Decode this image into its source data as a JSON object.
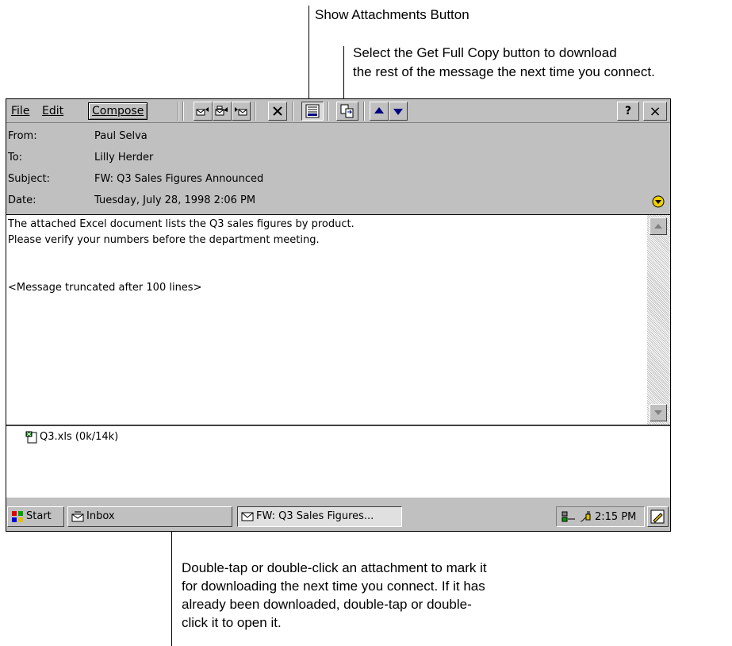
{
  "callouts": {
    "show_attachments": "Show Attachments Button",
    "get_full_copy_line1": "Select the Get Full Copy button to download",
    "get_full_copy_line2": "the rest of the message the next time you connect.",
    "attachment_line1": "Double-tap or double-click an attachment to mark it",
    "attachment_line2": "for downloading the next time you connect. If it has",
    "attachment_line3": "already been downloaded, double-tap or double-",
    "attachment_line4": "click it to open it."
  },
  "menu": {
    "file": "File",
    "edit": "Edit",
    "compose": "Compose",
    "help": "?",
    "close": "×"
  },
  "toolbar_icons": [
    "reply-icon",
    "reply-all-icon",
    "forward-icon",
    "delete-icon",
    "show-attachments-icon",
    "get-full-copy-icon",
    "previous-message-icon",
    "next-message-icon"
  ],
  "header": {
    "from_label": "From:",
    "from_value": "Paul Selva",
    "to_label": "To:",
    "to_value": "Lilly Herder",
    "subject_label": "Subject:",
    "subject_value": "FW: Q3 Sales Figures Announced",
    "date_label": "Date:",
    "date_value": "Tuesday, July 28, 1998 2:06 PM"
  },
  "body": {
    "line1": "The attached Excel document lists the Q3 sales figures by product.",
    "line2": "Please verify your numbers before the department meeting.",
    "truncated": "<Message truncated after 100 lines>"
  },
  "attachment": {
    "name": "Q3.xls (0k/14k)"
  },
  "taskbar": {
    "start": "Start",
    "inbox": "Inbox",
    "active_window": "FW: Q3 Sales Figures...",
    "clock": "2:15 PM"
  },
  "colors": {
    "window_gray": "#c0c0c0",
    "header_expand": "#f0d000"
  }
}
